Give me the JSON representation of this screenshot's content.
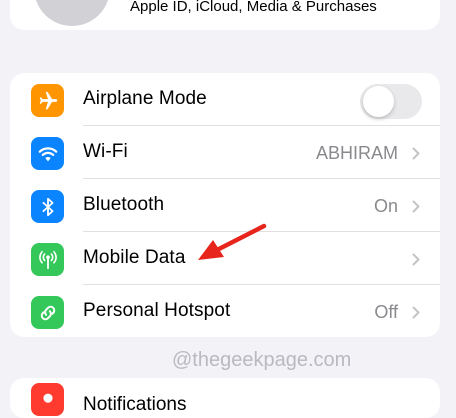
{
  "profile": {
    "subtitle": "Apple ID, iCloud, Media & Purchases"
  },
  "settings": {
    "airplane_mode": {
      "label": "Airplane Mode",
      "toggle_on": false,
      "icon": "airplane-icon",
      "color": "#ff9500"
    },
    "wifi": {
      "label": "Wi-Fi",
      "value": "ABHIRAM",
      "icon": "wifi-icon",
      "color": "#0a84ff"
    },
    "bluetooth": {
      "label": "Bluetooth",
      "value": "On",
      "icon": "bluetooth-icon",
      "color": "#0a84ff"
    },
    "mobile_data": {
      "label": "Mobile Data",
      "icon": "antenna-icon",
      "color": "#34c759"
    },
    "personal_hotspot": {
      "label": "Personal Hotspot",
      "value": "Off",
      "icon": "hotspot-link-icon",
      "color": "#34c759"
    }
  },
  "watermark": "@thegeekpage.com",
  "notifications": {
    "label": "Notifications",
    "icon": "bell-icon",
    "color": "#ff3b30"
  },
  "annotation": {
    "arrow_color": "#e8251c"
  }
}
